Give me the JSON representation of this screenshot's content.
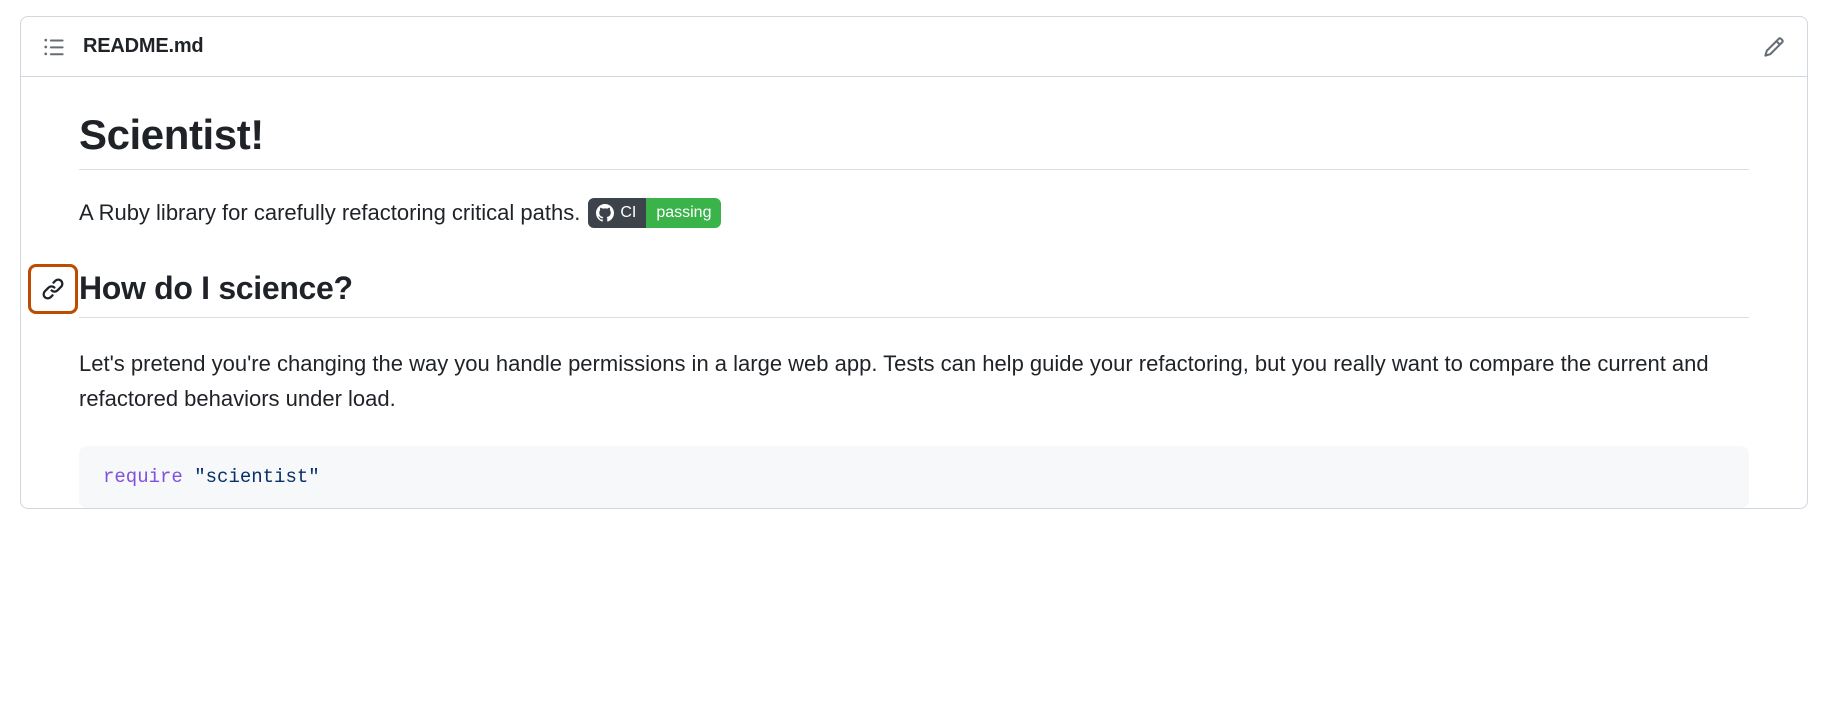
{
  "header": {
    "filename": "README.md"
  },
  "title": "Scientist!",
  "subtitle": "A Ruby library for carefully refactoring critical paths.",
  "badge": {
    "label": "CI",
    "status": "passing"
  },
  "section": {
    "heading": "How do I science?",
    "paragraph": "Let's pretend you're changing the way you handle permissions in a large web app. Tests can help guide your refactoring, but you really want to compare the current and refactored behaviors under load."
  },
  "code": {
    "keyword": "require",
    "space": " ",
    "string": "\"scientist\""
  }
}
